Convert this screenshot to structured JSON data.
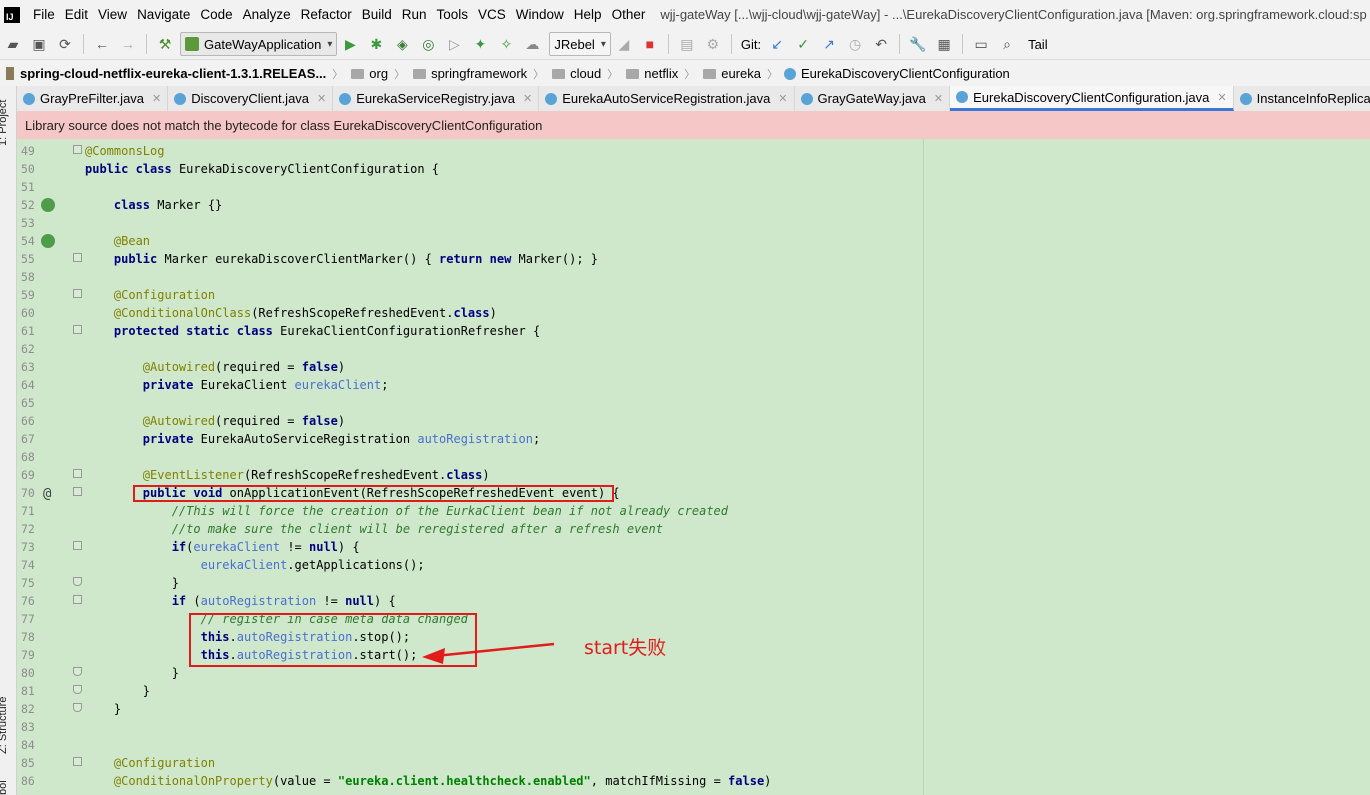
{
  "menu": {
    "items": [
      "File",
      "Edit",
      "View",
      "Navigate",
      "Code",
      "Analyze",
      "Refactor",
      "Build",
      "Run",
      "Tools",
      "VCS",
      "Window",
      "Help",
      "Other"
    ],
    "window_title": "wjj-gateWay [...\\wjj-cloud\\wjj-gateWay] - ...\\EurekaDiscoveryClientConfiguration.java [Maven: org.springframework.cloud:sp"
  },
  "toolbar": {
    "run_config": "GateWayApplication",
    "jrebel": "JRebel",
    "git_label": "Git:",
    "tail_label": "Tail"
  },
  "breadcrumb": {
    "jar": "spring-cloud-netflix-eureka-client-1.3.1.RELEAS...",
    "packages": [
      "org",
      "springframework",
      "cloud",
      "netflix",
      "eureka"
    ],
    "class": "EurekaDiscoveryClientConfiguration"
  },
  "tabs": [
    {
      "label": "GrayPreFilter.java",
      "active": false
    },
    {
      "label": "DiscoveryClient.java",
      "active": false
    },
    {
      "label": "EurekaServiceRegistry.java",
      "active": false
    },
    {
      "label": "EurekaAutoServiceRegistration.java",
      "active": false
    },
    {
      "label": "GrayGateWay.java",
      "active": false
    },
    {
      "label": "EurekaDiscoveryClientConfiguration.java",
      "active": true
    },
    {
      "label": "InstanceInfoReplicator",
      "active": false
    }
  ],
  "side_panel": {
    "project": "1: Project",
    "structure": "Z: Structure",
    "bottom": "bol"
  },
  "warning": "Library source does not match the bytecode for class EurekaDiscoveryClientConfiguration",
  "annotation_text": "start失败",
  "code_lines": [
    {
      "n": "49",
      "text": "@CommonsLog"
    },
    {
      "n": "50",
      "text": "public class EurekaDiscoveryClientConfiguration {"
    },
    {
      "n": "51",
      "text": ""
    },
    {
      "n": "52",
      "text": "    class Marker {}"
    },
    {
      "n": "53",
      "text": ""
    },
    {
      "n": "54",
      "text": "    @Bean"
    },
    {
      "n": "55",
      "text": "    public Marker eurekaDiscoverClientMarker() { return new Marker(); }"
    },
    {
      "n": "58",
      "text": ""
    },
    {
      "n": "59",
      "text": "    @Configuration"
    },
    {
      "n": "60",
      "text": "    @ConditionalOnClass(RefreshScopeRefreshedEvent.class)"
    },
    {
      "n": "61",
      "text": "    protected static class EurekaClientConfigurationRefresher {"
    },
    {
      "n": "62",
      "text": ""
    },
    {
      "n": "63",
      "text": "        @Autowired(required = false)"
    },
    {
      "n": "64",
      "text": "        private EurekaClient eurekaClient;"
    },
    {
      "n": "65",
      "text": ""
    },
    {
      "n": "66",
      "text": "        @Autowired(required = false)"
    },
    {
      "n": "67",
      "text": "        private EurekaAutoServiceRegistration autoRegistration;"
    },
    {
      "n": "68",
      "text": ""
    },
    {
      "n": "69",
      "text": "        @EventListener(RefreshScopeRefreshedEvent.class)"
    },
    {
      "n": "70",
      "text": "        public void onApplicationEvent(RefreshScopeRefreshedEvent event) {"
    },
    {
      "n": "71",
      "text": "            //This will force the creation of the EurkaClient bean if not already created"
    },
    {
      "n": "72",
      "text": "            //to make sure the client will be reregistered after a refresh event"
    },
    {
      "n": "73",
      "text": "            if(eurekaClient != null) {"
    },
    {
      "n": "74",
      "text": "                eurekaClient.getApplications();"
    },
    {
      "n": "75",
      "text": "            }"
    },
    {
      "n": "76",
      "text": "            if (autoRegistration != null) {"
    },
    {
      "n": "77",
      "text": "                // register in case meta data changed"
    },
    {
      "n": "78",
      "text": "                this.autoRegistration.stop();"
    },
    {
      "n": "79",
      "text": "                this.autoRegistration.start();"
    },
    {
      "n": "80",
      "text": "            }"
    },
    {
      "n": "81",
      "text": "        }"
    },
    {
      "n": "82",
      "text": "    }"
    },
    {
      "n": "83",
      "text": ""
    },
    {
      "n": "84",
      "text": ""
    },
    {
      "n": "85",
      "text": "    @Configuration"
    },
    {
      "n": "86",
      "text": "    @ConditionalOnProperty(value = \"eureka.client.healthcheck.enabled\", matchIfMissing = false)"
    }
  ]
}
